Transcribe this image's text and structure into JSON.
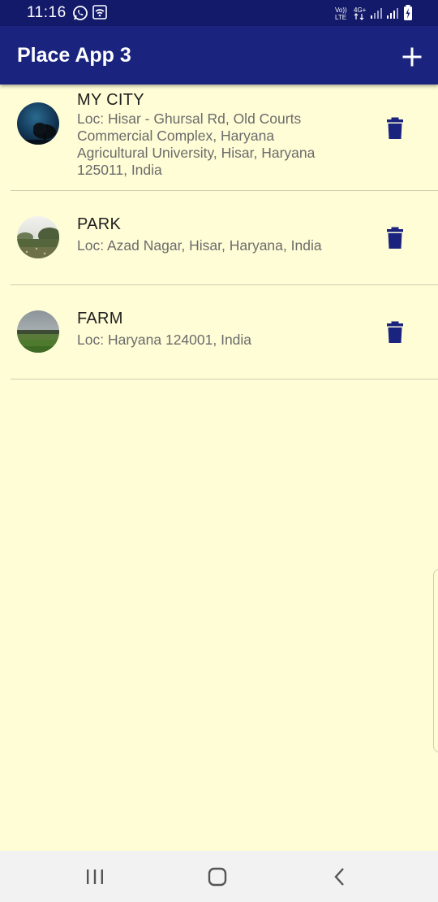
{
  "status_bar": {
    "time": "11:16",
    "icons": [
      "whatsapp-icon",
      "wifi-icon",
      "volte-icon",
      "4g-icon",
      "signal-icon",
      "signal-icon",
      "battery-charging-icon"
    ]
  },
  "app_bar": {
    "title": "Place App 3",
    "add_icon": "plus-icon"
  },
  "places": [
    {
      "title": "MY CITY",
      "address_prefix": "Loc: ",
      "address": "Hisar - Ghursal Rd, Old Courts Commercial Complex, Haryana Agricultural University, Hisar, Haryana 125011, India",
      "thumbnail": "night-tree-photo"
    },
    {
      "title": "PARK",
      "address_prefix": "Loc: ",
      "address": "Azad Nagar, Hisar, Haryana, India",
      "thumbnail": "park-photo"
    },
    {
      "title": "FARM",
      "address_prefix": "Loc: ",
      "address": "Haryana 124001, India",
      "thumbnail": "farm-photo"
    }
  ],
  "colors": {
    "primary": "#1a237e",
    "status_bar": "#131a6a",
    "background": "#fffdd6",
    "delete_icon": "#1a237e"
  },
  "nav_bar": {
    "icons": [
      "recent-apps-icon",
      "home-icon",
      "back-icon"
    ]
  }
}
